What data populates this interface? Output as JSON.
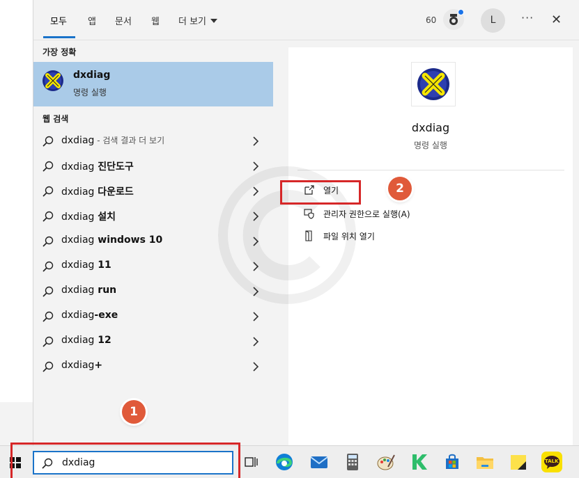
{
  "tabs": [
    {
      "label": "모두"
    },
    {
      "label": "앱"
    },
    {
      "label": "문서"
    },
    {
      "label": "웹"
    },
    {
      "label": "더 보기"
    }
  ],
  "header": {
    "points": "60",
    "avatar_initial": "L",
    "more": "···",
    "close": "✕"
  },
  "best_match": {
    "section_title": "가장 정확",
    "title": "dxdiag",
    "subtitle": "명령 실행"
  },
  "web": {
    "section_title": "웹 검색",
    "items": [
      {
        "query": "dxdiag",
        "suffix": " - 검색 결과 더 보기"
      },
      {
        "query": "dxdiag",
        "suffix": " 진단도구"
      },
      {
        "query": "dxdiag",
        "suffix": " 다운로드"
      },
      {
        "query": "dxdiag",
        "suffix": " 설치"
      },
      {
        "query": "dxdiag",
        "suffix": " windows 10"
      },
      {
        "query": "dxdiag",
        "suffix": " 11"
      },
      {
        "query": "dxdiag",
        "suffix": " run"
      },
      {
        "query": "dxdiag",
        "suffix": "-exe"
      },
      {
        "query": "dxdiag",
        "suffix": " 12"
      },
      {
        "query": "dxdiag",
        "suffix": "+"
      }
    ]
  },
  "detail": {
    "app_name": "dxdiag",
    "app_type": "명령 실행",
    "actions": [
      {
        "label": "열기",
        "icon": "open-icon"
      },
      {
        "label": "관리자 권한으로 실행(A)",
        "icon": "shield-icon"
      },
      {
        "label": "파일 위치 열기",
        "icon": "folder-location-icon"
      }
    ]
  },
  "taskbar": {
    "search_value": "dxdiag",
    "icons": [
      "task-view-icon",
      "edge-icon",
      "mail-icon",
      "calculator-icon",
      "paint-icon",
      "app-k-icon",
      "store-icon",
      "file-explorer-icon",
      "sticky-notes-icon",
      "kakaotalk-icon"
    ],
    "kakao_label": "TALK"
  },
  "annotations": {
    "step1": "1",
    "step2": "2"
  },
  "colors": {
    "accent": "#1a73c9",
    "selected": "#aacbe8",
    "annotation": "#d62728",
    "badge": "#e05a3a"
  }
}
